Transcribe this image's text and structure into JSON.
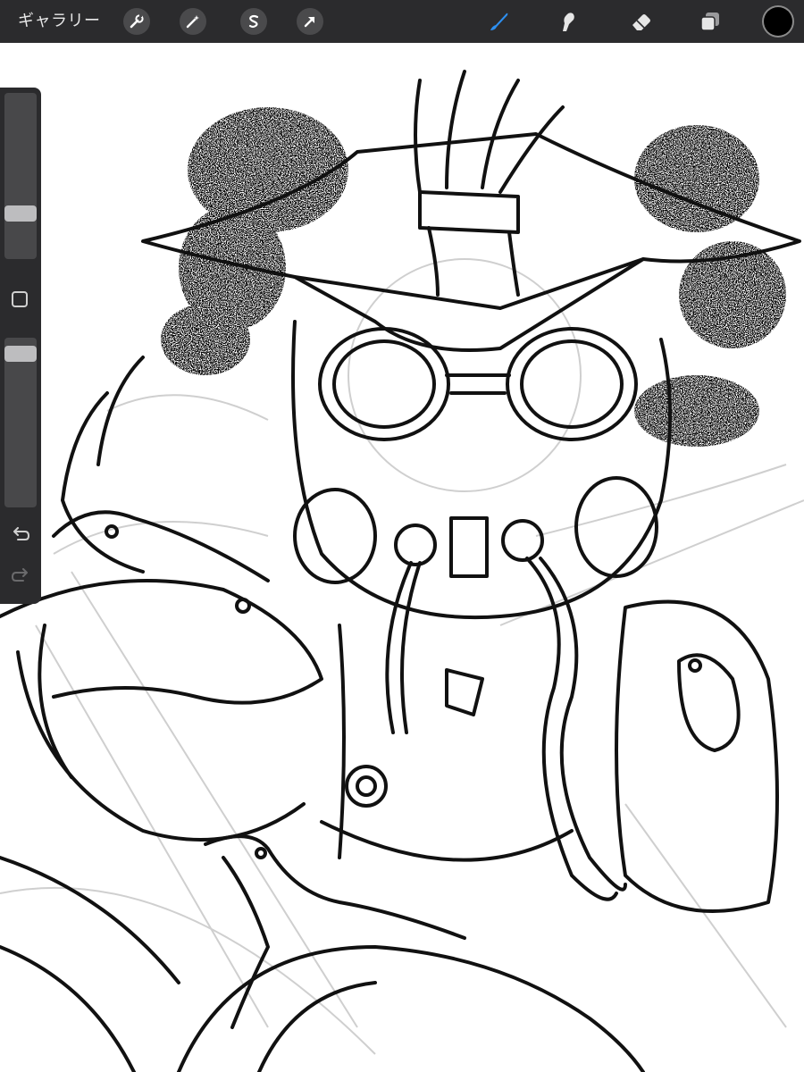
{
  "toolbar": {
    "gallery_label": "ギャラリー",
    "actions": [
      {
        "id": "actions",
        "icon": "wrench-icon"
      },
      {
        "id": "adjustments",
        "icon": "magic-wand-icon"
      },
      {
        "id": "selection",
        "icon": "selection-s-icon"
      },
      {
        "id": "transform",
        "icon": "arrow-cursor-icon"
      }
    ],
    "tools": [
      {
        "id": "brush",
        "icon": "brush-icon",
        "active": true
      },
      {
        "id": "smudge",
        "icon": "smudge-finger-icon",
        "active": false
      },
      {
        "id": "eraser",
        "icon": "eraser-icon",
        "active": false
      },
      {
        "id": "layers",
        "icon": "layers-icon",
        "active": false
      }
    ],
    "current_color": "#000000",
    "active_tool_color": "#2d8ff0",
    "bar_color": "#2b2b2d"
  },
  "sidebar": {
    "brush_size_level": 0.25,
    "opacity_level": 0.95,
    "modify_icon": "square-icon",
    "undo_icon": "undo-icon",
    "redo_icon": "redo-icon"
  }
}
